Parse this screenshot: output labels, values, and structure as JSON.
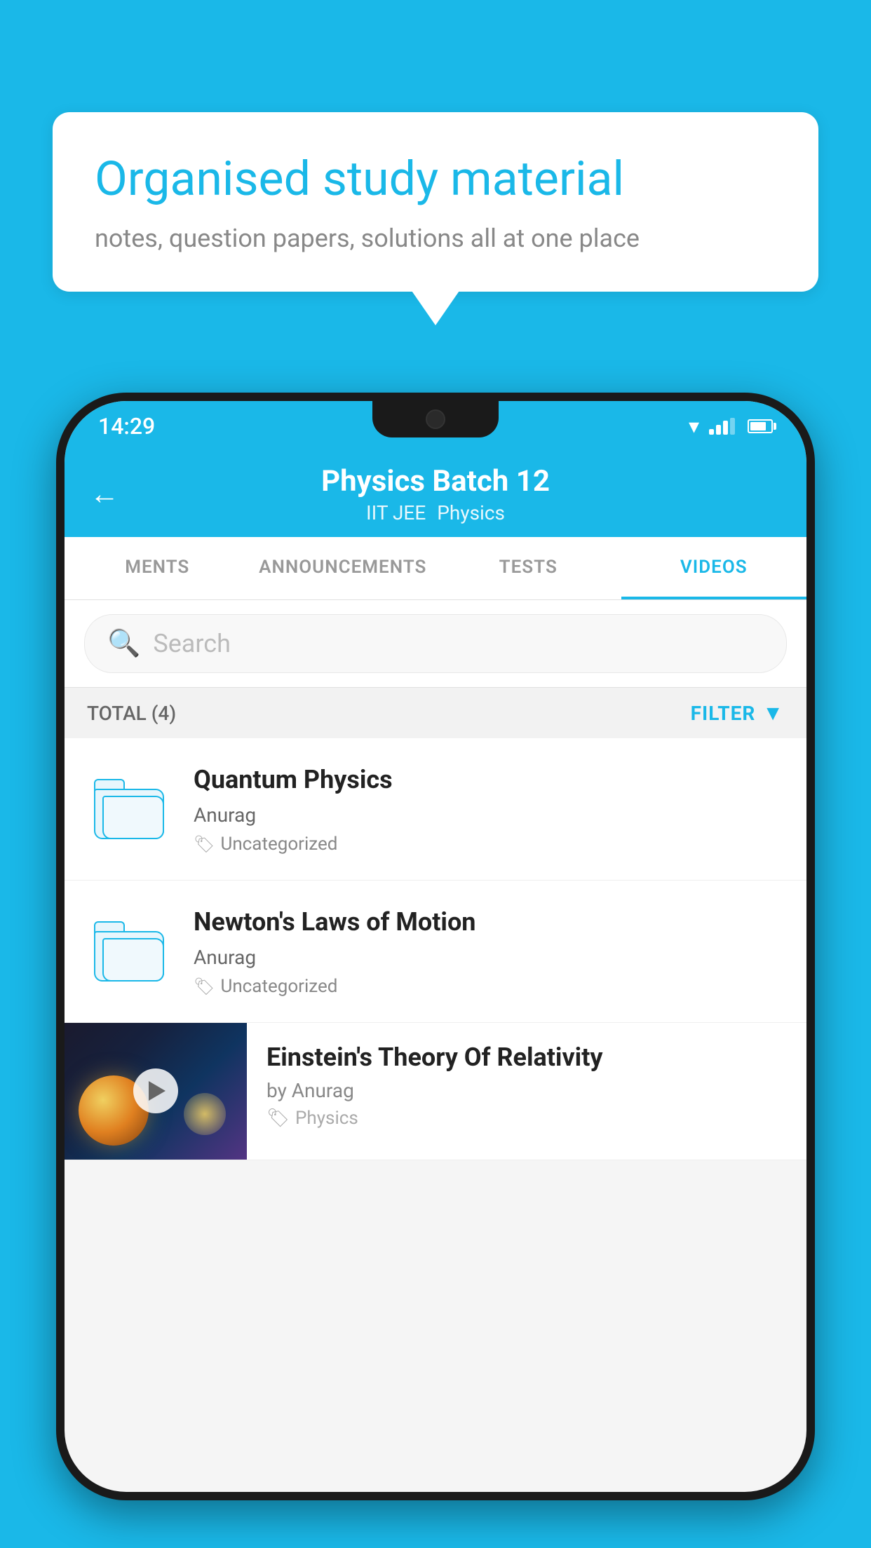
{
  "background_color": "#1ab8e8",
  "bubble": {
    "title": "Organised study material",
    "subtitle": "notes, question papers, solutions all at one place"
  },
  "phone": {
    "status_bar": {
      "time": "14:29"
    },
    "header": {
      "title": "Physics Batch 12",
      "subtitle1": "IIT JEE",
      "subtitle2": "Physics",
      "back_label": "←"
    },
    "tabs": [
      {
        "label": "MENTS",
        "active": false
      },
      {
        "label": "ANNOUNCEMENTS",
        "active": false
      },
      {
        "label": "TESTS",
        "active": false
      },
      {
        "label": "VIDEOS",
        "active": true
      }
    ],
    "search": {
      "placeholder": "Search"
    },
    "filter": {
      "total_label": "TOTAL (4)",
      "filter_label": "FILTER"
    },
    "videos": [
      {
        "title": "Quantum Physics",
        "author": "Anurag",
        "tag": "Uncategorized",
        "type": "folder"
      },
      {
        "title": "Newton's Laws of Motion",
        "author": "Anurag",
        "tag": "Uncategorized",
        "type": "folder"
      },
      {
        "title": "Einstein's Theory Of Relativity",
        "author": "by Anurag",
        "tag": "Physics",
        "type": "video"
      }
    ]
  }
}
